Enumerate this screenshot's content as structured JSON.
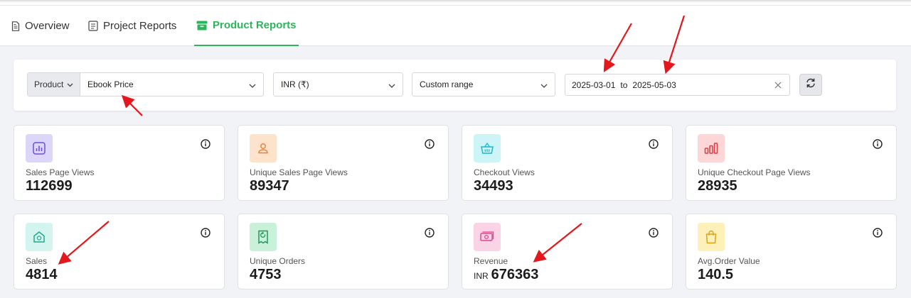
{
  "tabs": [
    {
      "label": "Overview",
      "icon": "document-icon",
      "active": false
    },
    {
      "label": "Project Reports",
      "icon": "report-icon",
      "active": false
    },
    {
      "label": "Product Reports",
      "icon": "box-icon",
      "active": true
    }
  ],
  "filters": {
    "product_label": "Product",
    "product_value": "Ebook Price",
    "currency_value": "INR (₹)",
    "range_value": "Custom range",
    "date_from": "2025-03-01",
    "date_sep": "to",
    "date_to": "2025-05-03"
  },
  "metrics": [
    {
      "label": "Sales Page Views",
      "value": "112699",
      "icon": "bar-chart-icon",
      "bg": "#ddd6fb",
      "fg": "#6b4fd8"
    },
    {
      "label": "Unique Sales Page Views",
      "value": "89347",
      "icon": "user-icon",
      "bg": "#fde2cc",
      "fg": "#e8833a"
    },
    {
      "label": "Checkout Views",
      "value": "34493",
      "icon": "basket-icon",
      "bg": "#cdf5f8",
      "fg": "#1fb8c9"
    },
    {
      "label": "Unique Checkout Page Views",
      "value": "28935",
      "icon": "column-chart-icon",
      "bg": "#fdd7d7",
      "fg": "#e0393e"
    },
    {
      "label": "Sales",
      "value": "4814",
      "icon": "home-dollar-icon",
      "bg": "#d3f4ef",
      "fg": "#26a88f"
    },
    {
      "label": "Unique Orders",
      "value": "4753",
      "icon": "receipt-icon",
      "bg": "#c9f0d8",
      "fg": "#22965a"
    },
    {
      "label": "Revenue",
      "value": "676363",
      "currency": "INR",
      "icon": "cash-icon",
      "bg": "#fbd3e6",
      "fg": "#e0458f"
    },
    {
      "label": "Avg.Order Value",
      "value": "140.5",
      "icon": "shopping-bag-icon",
      "bg": "#fdf0b8",
      "fg": "#d9a515"
    }
  ],
  "colors": {
    "accent": "#2db55d",
    "annotation": "#e3171c"
  }
}
